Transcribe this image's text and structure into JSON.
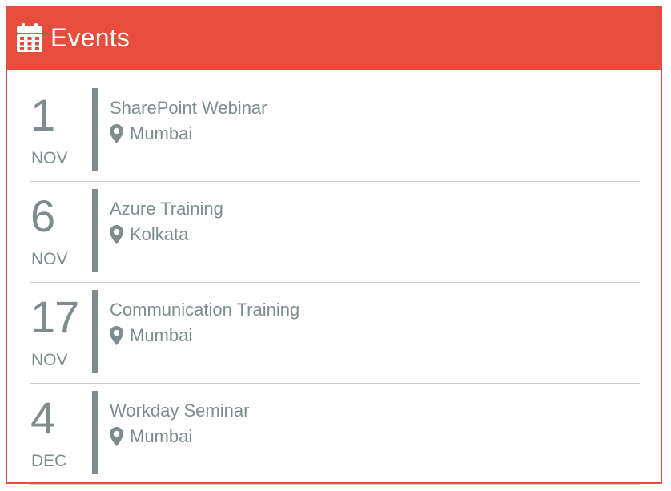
{
  "header": {
    "title": "Events",
    "icon": "calendar-icon",
    "background": "#e84c3d"
  },
  "colors": {
    "accent": "#e84c3d",
    "text": "#7f8c8d",
    "divider": "#c8cccc"
  },
  "events": [
    {
      "day": "1",
      "month": "NOV",
      "title": "SharePoint Webinar",
      "location": "Mumbai"
    },
    {
      "day": "6",
      "month": "NOV",
      "title": "Azure Training",
      "location": "Kolkata"
    },
    {
      "day": "17",
      "month": "NOV",
      "title": "Communication Training",
      "location": "Mumbai"
    },
    {
      "day": "4",
      "month": "DEC",
      "title": "Workday Seminar",
      "location": "Mumbai"
    }
  ]
}
